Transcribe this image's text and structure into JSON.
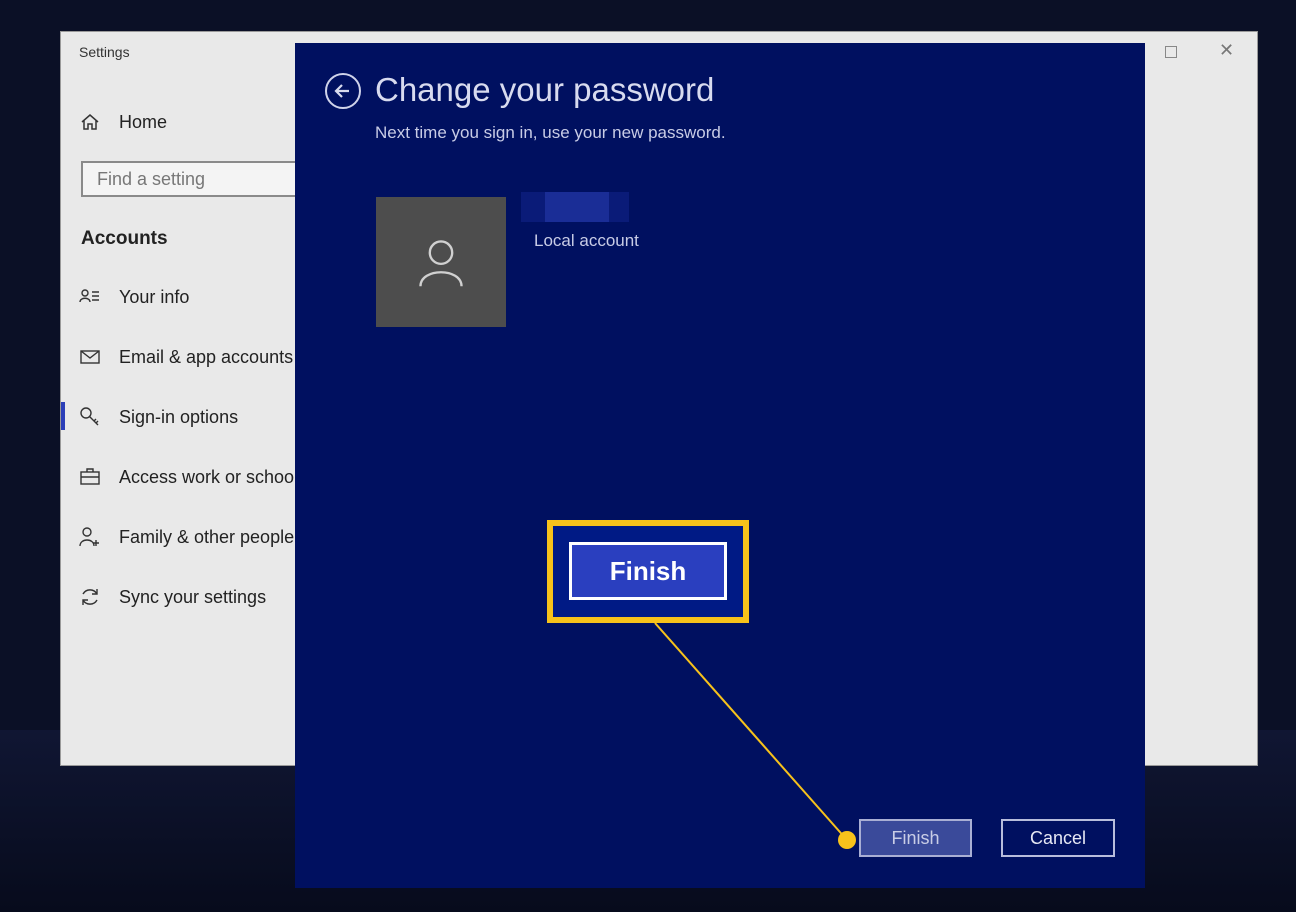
{
  "settings": {
    "title": "Settings",
    "home_label": "Home",
    "search": {
      "placeholder": "Find a setting"
    },
    "section_header": "Accounts",
    "nav_items": [
      {
        "label": "Your info",
        "icon": "contact-card-icon"
      },
      {
        "label": "Email & app accounts",
        "icon": "mail-icon"
      },
      {
        "label": "Sign-in options",
        "icon": "key-icon",
        "active": true
      },
      {
        "label": "Access work or school",
        "icon": "briefcase-icon"
      },
      {
        "label": "Family & other people",
        "icon": "add-person-icon"
      },
      {
        "label": "Sync your settings",
        "icon": "sync-icon"
      }
    ]
  },
  "dialog": {
    "title": "Change your password",
    "subtitle": "Next time you sign in, use your new password.",
    "account_type": "Local account",
    "zoom_label": "Finish",
    "finish_label": "Finish",
    "cancel_label": "Cancel"
  },
  "colors": {
    "dialog_bg": "#001060",
    "highlight": "#f7c21b",
    "settings_bg": "#e9e9e9"
  }
}
